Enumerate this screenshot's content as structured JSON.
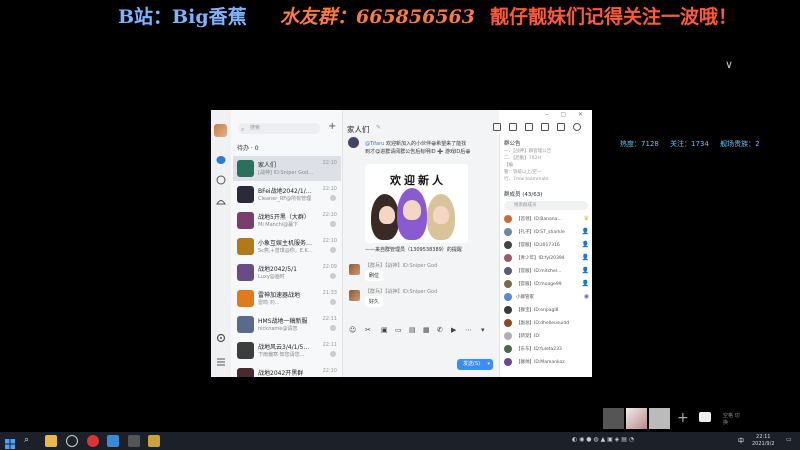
{
  "banner": {
    "left": "B站：Big香蕉",
    "middle": "水友群：665856563",
    "right": "靓仔靓妹们记得关注一波哦！"
  },
  "stream_stats": {
    "popularity": "热度：7128",
    "follows": "关注：1734",
    "guard": "舰场贵族：2"
  },
  "window": {
    "search_placeholder": "搜索",
    "todo": "待办 · 0",
    "chat_list": [
      {
        "name": "家人们",
        "preview": "[战神] ID:Sniper God…",
        "time": "22:10",
        "avatar_color": "#2b6f5c",
        "selected": true
      },
      {
        "name": "BFei战地2042/1/…",
        "preview": "Cleaner_RF@所有管理",
        "time": "22:10",
        "avatar_color": "#2a2a3a",
        "selected": false
      },
      {
        "name": "战地5开黑（大群）",
        "preview": "Mi Manchi@赢下",
        "time": "22:10",
        "avatar_color": "#7a3d6e",
        "selected": false
      },
      {
        "name": "小象互娱主机服务…",
        "preview": "Sc燕,+曾琪@你，E.K…",
        "time": "22:10",
        "avatar_color": "#b07a1a",
        "selected": false
      },
      {
        "name": "战地2042/5/1",
        "preview": "Luxy@画时",
        "time": "22:09",
        "avatar_color": "#6b4a8a",
        "selected": false
      },
      {
        "name": "雷神加速器战地",
        "preview": "雷鸣·刘…",
        "time": "21:33",
        "avatar_color": "#e07a1a",
        "selected": false
      },
      {
        "name": "HMS战地一稿新服",
        "preview": "nickname@请您",
        "time": "22:11",
        "avatar_color": "#5a6a8a",
        "selected": false
      },
      {
        "name": "战地风云3/4/1/5…",
        "preview": "下雨偏寒·知您请您…",
        "time": "22:11",
        "avatar_color": "#3d3d3d",
        "selected": false
      },
      {
        "name": "战地2042开黑群",
        "preview": "",
        "time": "22:10",
        "avatar_color": "#4a2a2a",
        "selected": false
      }
    ],
    "chat": {
      "title": "家人们",
      "welcome_mention": "@Tifaru",
      "welcome_text": "欢迎新加入的小伙伴😀希望来了能找到才😋进群请阅群公告后标明ID ➕ 游戏ID后😀",
      "sticker_text": "欢迎新人",
      "signature": "——来自群管理员（1309538389）的提醒",
      "messages": [
        {
          "sender": "【群兵】【战神】ID:Sniper God",
          "text": "刷位"
        },
        {
          "sender": "【群兵】【战神】ID:Sniper God",
          "text": "好久"
        }
      ],
      "send_label": "发送(S)"
    },
    "side": {
      "announcement_title": "群公告",
      "announcement_lines": [
        "一、【战神】群管理公告",
        "二、【后勤】TR2H",
        "                【编",
        "警：等级以上/空一",
        "行，7mw teammate"
      ],
      "members_title": "群成员 (43/63)",
      "members_search": "搜索群成员",
      "members": [
        {
          "name": "【首领】ID:Banana…",
          "color": "#c96a3a",
          "role": "crown"
        },
        {
          "name": "【礼子】ID:ST_sharkle",
          "color": "#6a8aa0",
          "role": "admin"
        },
        {
          "name": "【官服】ID:z017316",
          "color": "#444",
          "role": "admin"
        },
        {
          "name": "【青少年】ID:fyl20394",
          "color": "#a05a6a",
          "role": "admin"
        },
        {
          "name": "【官服】ID:mitchel…",
          "color": "#5a5a7a",
          "role": "admin"
        },
        {
          "name": "【官服】ID:moage99",
          "color": "#7a6a4a",
          "role": "admin"
        },
        {
          "name": "小群管家",
          "color": "#5a8acf",
          "role": "bot"
        },
        {
          "name": "【群宝】ID:onpagl8",
          "color": "#3a3a3a",
          "role": ""
        },
        {
          "name": "【副总】ID:dhelleusuidd",
          "color": "#8a4a2a",
          "role": ""
        },
        {
          "name": "【新宠】ID:",
          "color": "#b0b0b0",
          "role": ""
        },
        {
          "name": "【东东】ID:fuleta233",
          "color": "#4a6a4a",
          "role": ""
        },
        {
          "name": "【群帅】ID:Mamankaz",
          "color": "#6a4a8a",
          "role": ""
        }
      ]
    }
  },
  "taskbar": {
    "clock_time": "22:11",
    "clock_date": "2021/9/2",
    "ime": "中",
    "tray_text": "空格 切换"
  },
  "colors": {
    "accent": "#3b8df7",
    "banner_blue": "#7fb3ff",
    "banner_orange": "#ff7a3c",
    "banner_red": "#ff5a3a",
    "stats_cyan": "#5ec6ff"
  }
}
